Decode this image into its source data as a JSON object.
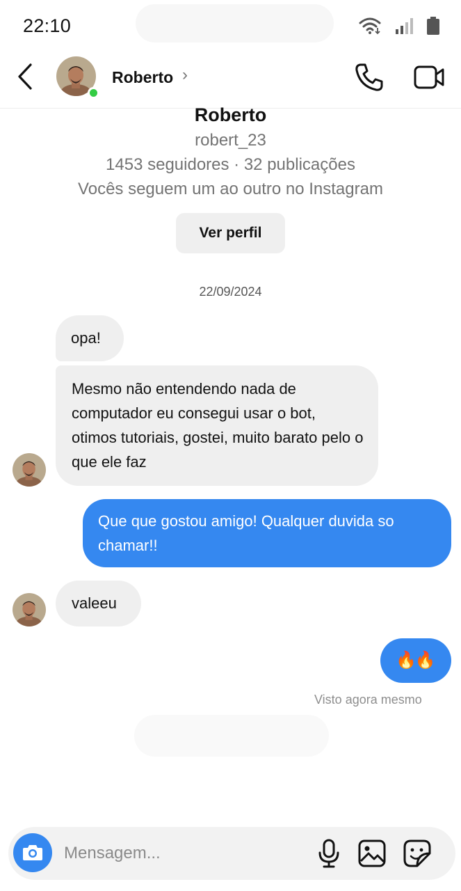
{
  "status_bar": {
    "time": "22:10",
    "icons": [
      "wifi-icon",
      "signal-icon",
      "battery-icon"
    ]
  },
  "header": {
    "contact_name": "Roberto",
    "chevron": "›",
    "online": true,
    "icons": [
      "back-icon",
      "phone-icon",
      "video-icon"
    ]
  },
  "profile": {
    "name": "Roberto",
    "username": "robert_23",
    "stats": "1453 seguidores · 32 publicações",
    "follow_info": "Vocês seguem um ao outro no Instagram",
    "view_profile_label": "Ver perfil"
  },
  "chat": {
    "date": "22/09/2024",
    "messages": [
      {
        "from": "them",
        "text": "opa!"
      },
      {
        "from": "them",
        "text": "Mesmo não entendendo nada de computador eu consegui usar o bot, otimos tutoriais, gostei, muito barato pelo o que ele faz"
      },
      {
        "from": "me",
        "text": "Que que gostou amigo! Qualquer duvida so chamar!!"
      },
      {
        "from": "them",
        "text": "valeeu"
      },
      {
        "from": "me",
        "text": "🔥🔥"
      }
    ],
    "seen_label": "Visto agora mesmo"
  },
  "composer": {
    "placeholder": "Mensagem...",
    "icons": [
      "camera-icon",
      "microphone-icon",
      "gallery-icon",
      "sticker-icon"
    ]
  },
  "colors": {
    "accent": "#3588f0",
    "incoming_bubble": "#efefef",
    "online": "#33cc44",
    "secondary_text": "#737373"
  }
}
